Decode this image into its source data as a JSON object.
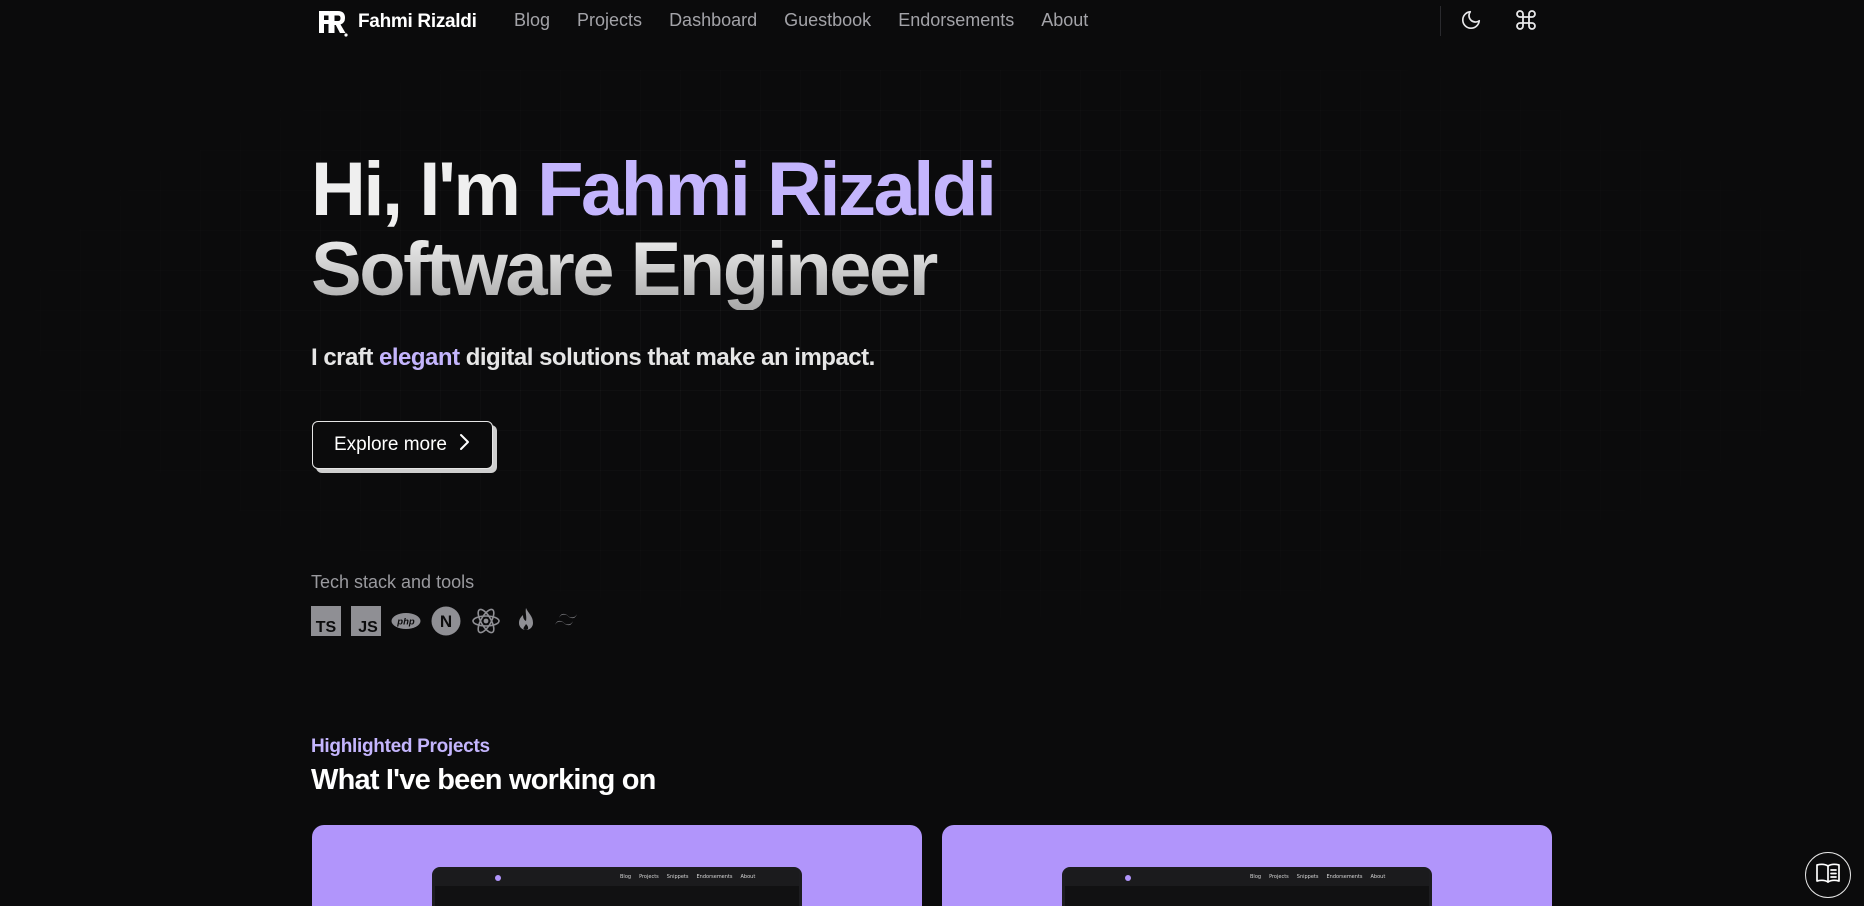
{
  "nav": {
    "brand_name": "Fahmi Rizaldi",
    "links": [
      {
        "label": "Blog"
      },
      {
        "label": "Projects"
      },
      {
        "label": "Dashboard"
      },
      {
        "label": "Guestbook"
      },
      {
        "label": "Endorsements"
      },
      {
        "label": "About"
      }
    ],
    "icons": {
      "theme": "moon-icon",
      "command": "command-icon"
    }
  },
  "hero": {
    "greeting": "Hi, I'm ",
    "name": "Fahmi Rizaldi",
    "role": "Software Engineer",
    "tagline_before": "I craft ",
    "tagline_accent": "elegant",
    "tagline_after": " digital solutions that make an impact.",
    "cta_label": "Explore more",
    "cta_icon": "chevron-right-icon"
  },
  "tech": {
    "label": "Tech stack and tools",
    "icons": [
      "typescript-icon",
      "javascript-icon",
      "php-icon",
      "nextjs-icon",
      "react-icon",
      "firebase-icon",
      "tailwind-icon"
    ],
    "ts_text": "TS",
    "js_text": "JS",
    "php_text": "php",
    "next_text": "N"
  },
  "projects": {
    "kicker": "Highlighted Projects",
    "title": "What I've been working on",
    "mini_nav_links": [
      "Blog",
      "Projects",
      "Snippets",
      "Endorsements",
      "About"
    ]
  },
  "colors": {
    "accent": "#c4b5fd",
    "card": "#b195fb",
    "background": "#0b0b0c"
  },
  "floating": {
    "reader_icon": "book-open-icon"
  }
}
